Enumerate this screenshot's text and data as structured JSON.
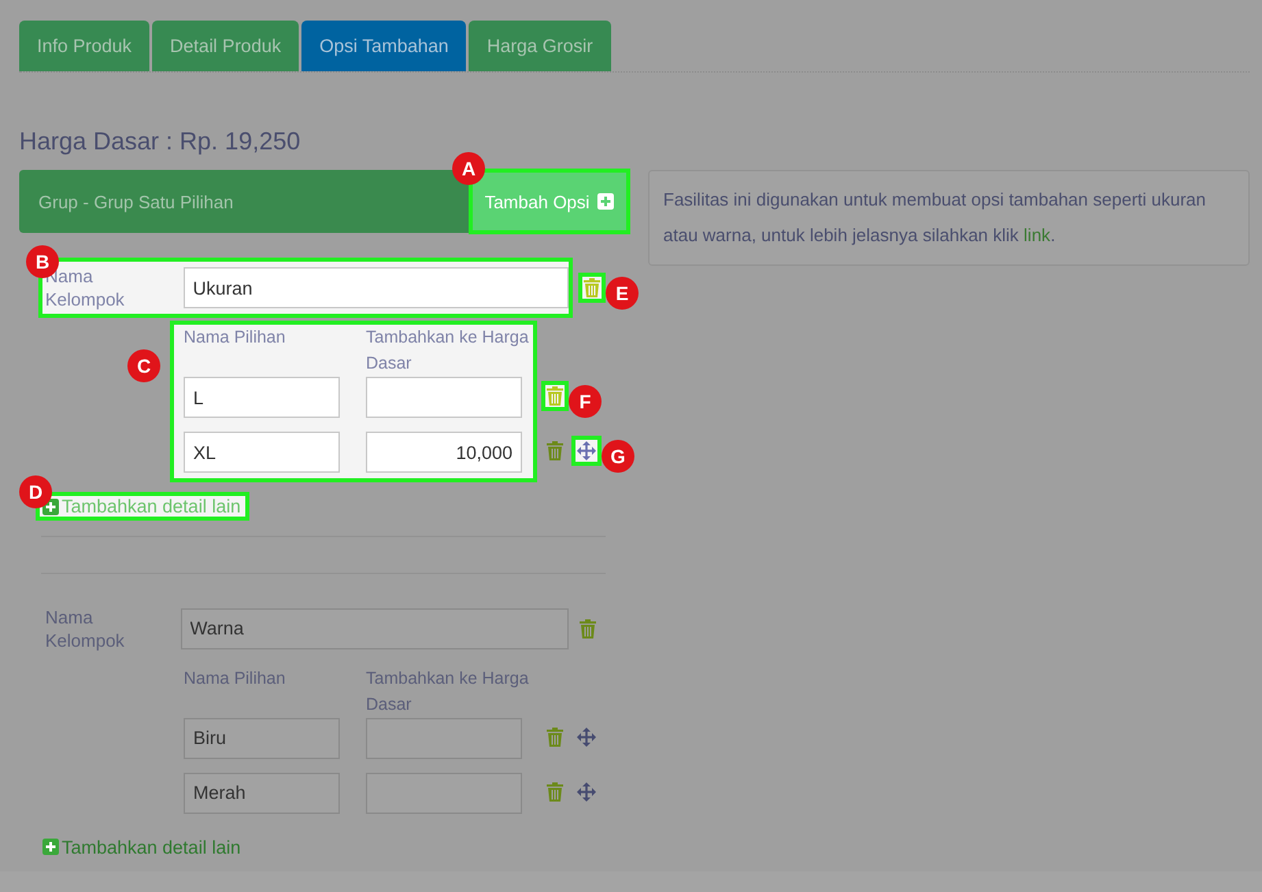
{
  "tabs": [
    {
      "label": "Info Produk",
      "selected": false
    },
    {
      "label": "Detail Produk",
      "selected": false
    },
    {
      "label": "Opsi Tambahan",
      "selected": true
    },
    {
      "label": "Harga Grosir",
      "selected": false
    }
  ],
  "base_price": "Harga Dasar : Rp. 19,250",
  "group_bar": {
    "title": "Grup - Grup Satu Pilihan",
    "add_button": {
      "label": "Tambah Opsi",
      "callout": "A"
    }
  },
  "info": {
    "text": "Fasilitas ini digunakan untuk membuat opsi tambahan seperti ukuran atau warna, untuk lebih jelasnya silahkan klik ",
    "link": "link",
    "end": "."
  },
  "groups": [
    {
      "name_label": "Nama Kelompok",
      "name_value": "Ukuran",
      "name_callout": "B",
      "delete_callout": "E",
      "columns": [
        "Nama Pilihan",
        "Tambahkan ke Harga Dasar"
      ],
      "options_callout": "C",
      "options": [
        {
          "name": "L",
          "delete_callout": "F"
        },
        {
          "name": "XL",
          "price": "10,000",
          "movable": true,
          "move_callout": "G"
        }
      ],
      "add_label": "Tambahkan detail lain",
      "add_callout": "D"
    },
    {
      "name_label": "Nama Kelompok",
      "name_value": "Warna",
      "columns": [
        "Nama Pilihan",
        "Tambahkan ke Harga Dasar"
      ],
      "options": [
        {
          "name": "Biru",
          "movable": true
        },
        {
          "name": "Merah",
          "movable": true
        }
      ],
      "add_label": "Tambahkan detail lain"
    }
  ]
}
